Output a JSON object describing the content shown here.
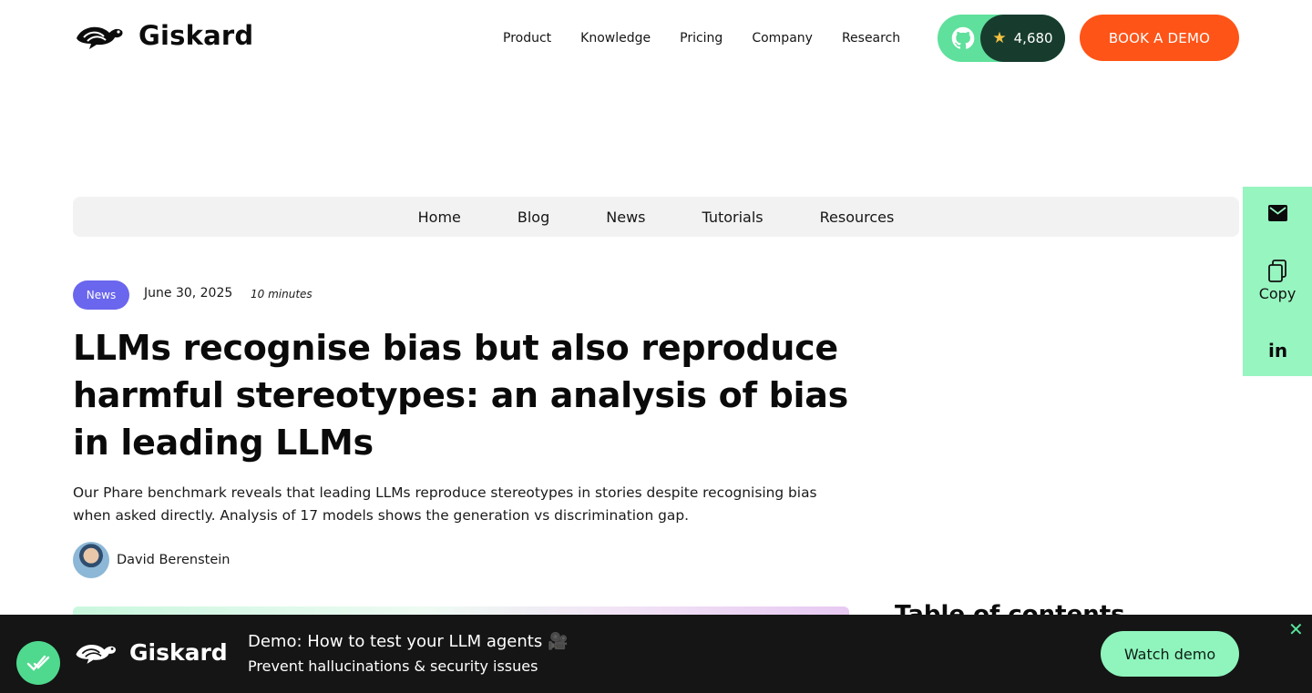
{
  "header": {
    "brand": "Giskard",
    "nav": [
      "Product",
      "Knowledge",
      "Pricing",
      "Company",
      "Research"
    ],
    "github": {
      "icon": "github-icon",
      "stars": "4,680"
    },
    "cta": "BOOK A DEMO"
  },
  "subnav": [
    "Home",
    "Blog",
    "News",
    "Tutorials",
    "Resources"
  ],
  "share": {
    "mail_icon": "mail-icon",
    "copy_label": "Copy",
    "linkedin": "in"
  },
  "article": {
    "category": "News",
    "date": "June 30, 2025",
    "read_time": "10 minutes",
    "title": "LLMs recognise bias but also reproduce harmful stereotypes: an analysis of bias in leading LLMs",
    "lede": "Our Phare benchmark reveals that leading LLMs reproduce stereotypes in stories despite recognising bias when asked directly. Analysis of 17 models shows the generation vs discrimination gap.",
    "author": "David Berenstein"
  },
  "sidebar": {
    "toc_heading": "Table of contents"
  },
  "banner": {
    "brand": "Giskard",
    "title": "Demo: How to test your LLM agents 🎥",
    "subtitle": "Prevent hallucinations & security issues",
    "button": "Watch demo",
    "close": "✕"
  },
  "colors": {
    "accent_orange": "#ff5417",
    "accent_green": "#5fe09c",
    "share_green": "#97f5c0",
    "badge_purple": "#6a66ed",
    "banner_bg": "#151515"
  }
}
